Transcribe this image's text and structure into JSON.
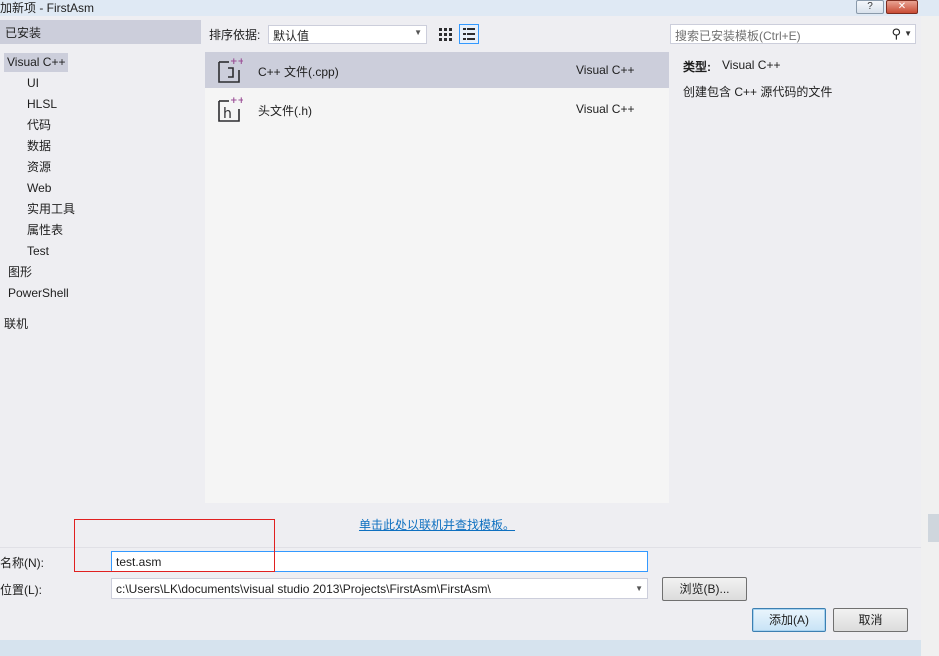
{
  "window": {
    "title": "加新项 - FirstAsm",
    "help_label": "?",
    "close_label": "✕"
  },
  "tree": {
    "header": "已安装",
    "items": [
      {
        "label": "Visual C++",
        "selected": true
      },
      {
        "label": "UI"
      },
      {
        "label": "HLSL"
      },
      {
        "label": "代码"
      },
      {
        "label": "数据"
      },
      {
        "label": "资源"
      },
      {
        "label": "Web"
      },
      {
        "label": "实用工具"
      },
      {
        "label": "属性表"
      },
      {
        "label": "Test"
      },
      {
        "label": "图形"
      },
      {
        "label": "PowerShell"
      },
      {
        "label": "联机"
      }
    ]
  },
  "toolbar": {
    "sort_label": "排序依据:",
    "sort_value": "默认值",
    "grid_view_icon": "grid-view-icon",
    "list_view_icon": "list-view-icon"
  },
  "search": {
    "placeholder": "搜索已安装模板(Ctrl+E)",
    "icon": "search-icon"
  },
  "templates": [
    {
      "name": "C++ 文件(.cpp)",
      "language": "Visual C++",
      "icon": "cpp-file-icon",
      "selected": true
    },
    {
      "name": "头文件(.h)",
      "language": "Visual C++",
      "icon": "header-file-icon",
      "selected": false
    }
  ],
  "info": {
    "type_label": "类型:",
    "type_value": "Visual C++",
    "description": "创建包含 C++ 源代码的文件"
  },
  "online_link": "单击此处以联机并查找模板。",
  "form": {
    "name_label": "名称(N):",
    "name_value": "test.asm",
    "location_label": "位置(L):",
    "location_value": "c:\\Users\\LK\\documents\\visual studio 2013\\Projects\\FirstAsm\\FirstAsm\\",
    "browse_label": "浏览(B)...",
    "add_label": "添加(A)",
    "cancel_label": "取消"
  },
  "colors": {
    "selection": "#cccedb",
    "link": "#0e70c0",
    "focus_border": "#3399ff",
    "annotation": "#e02020"
  }
}
